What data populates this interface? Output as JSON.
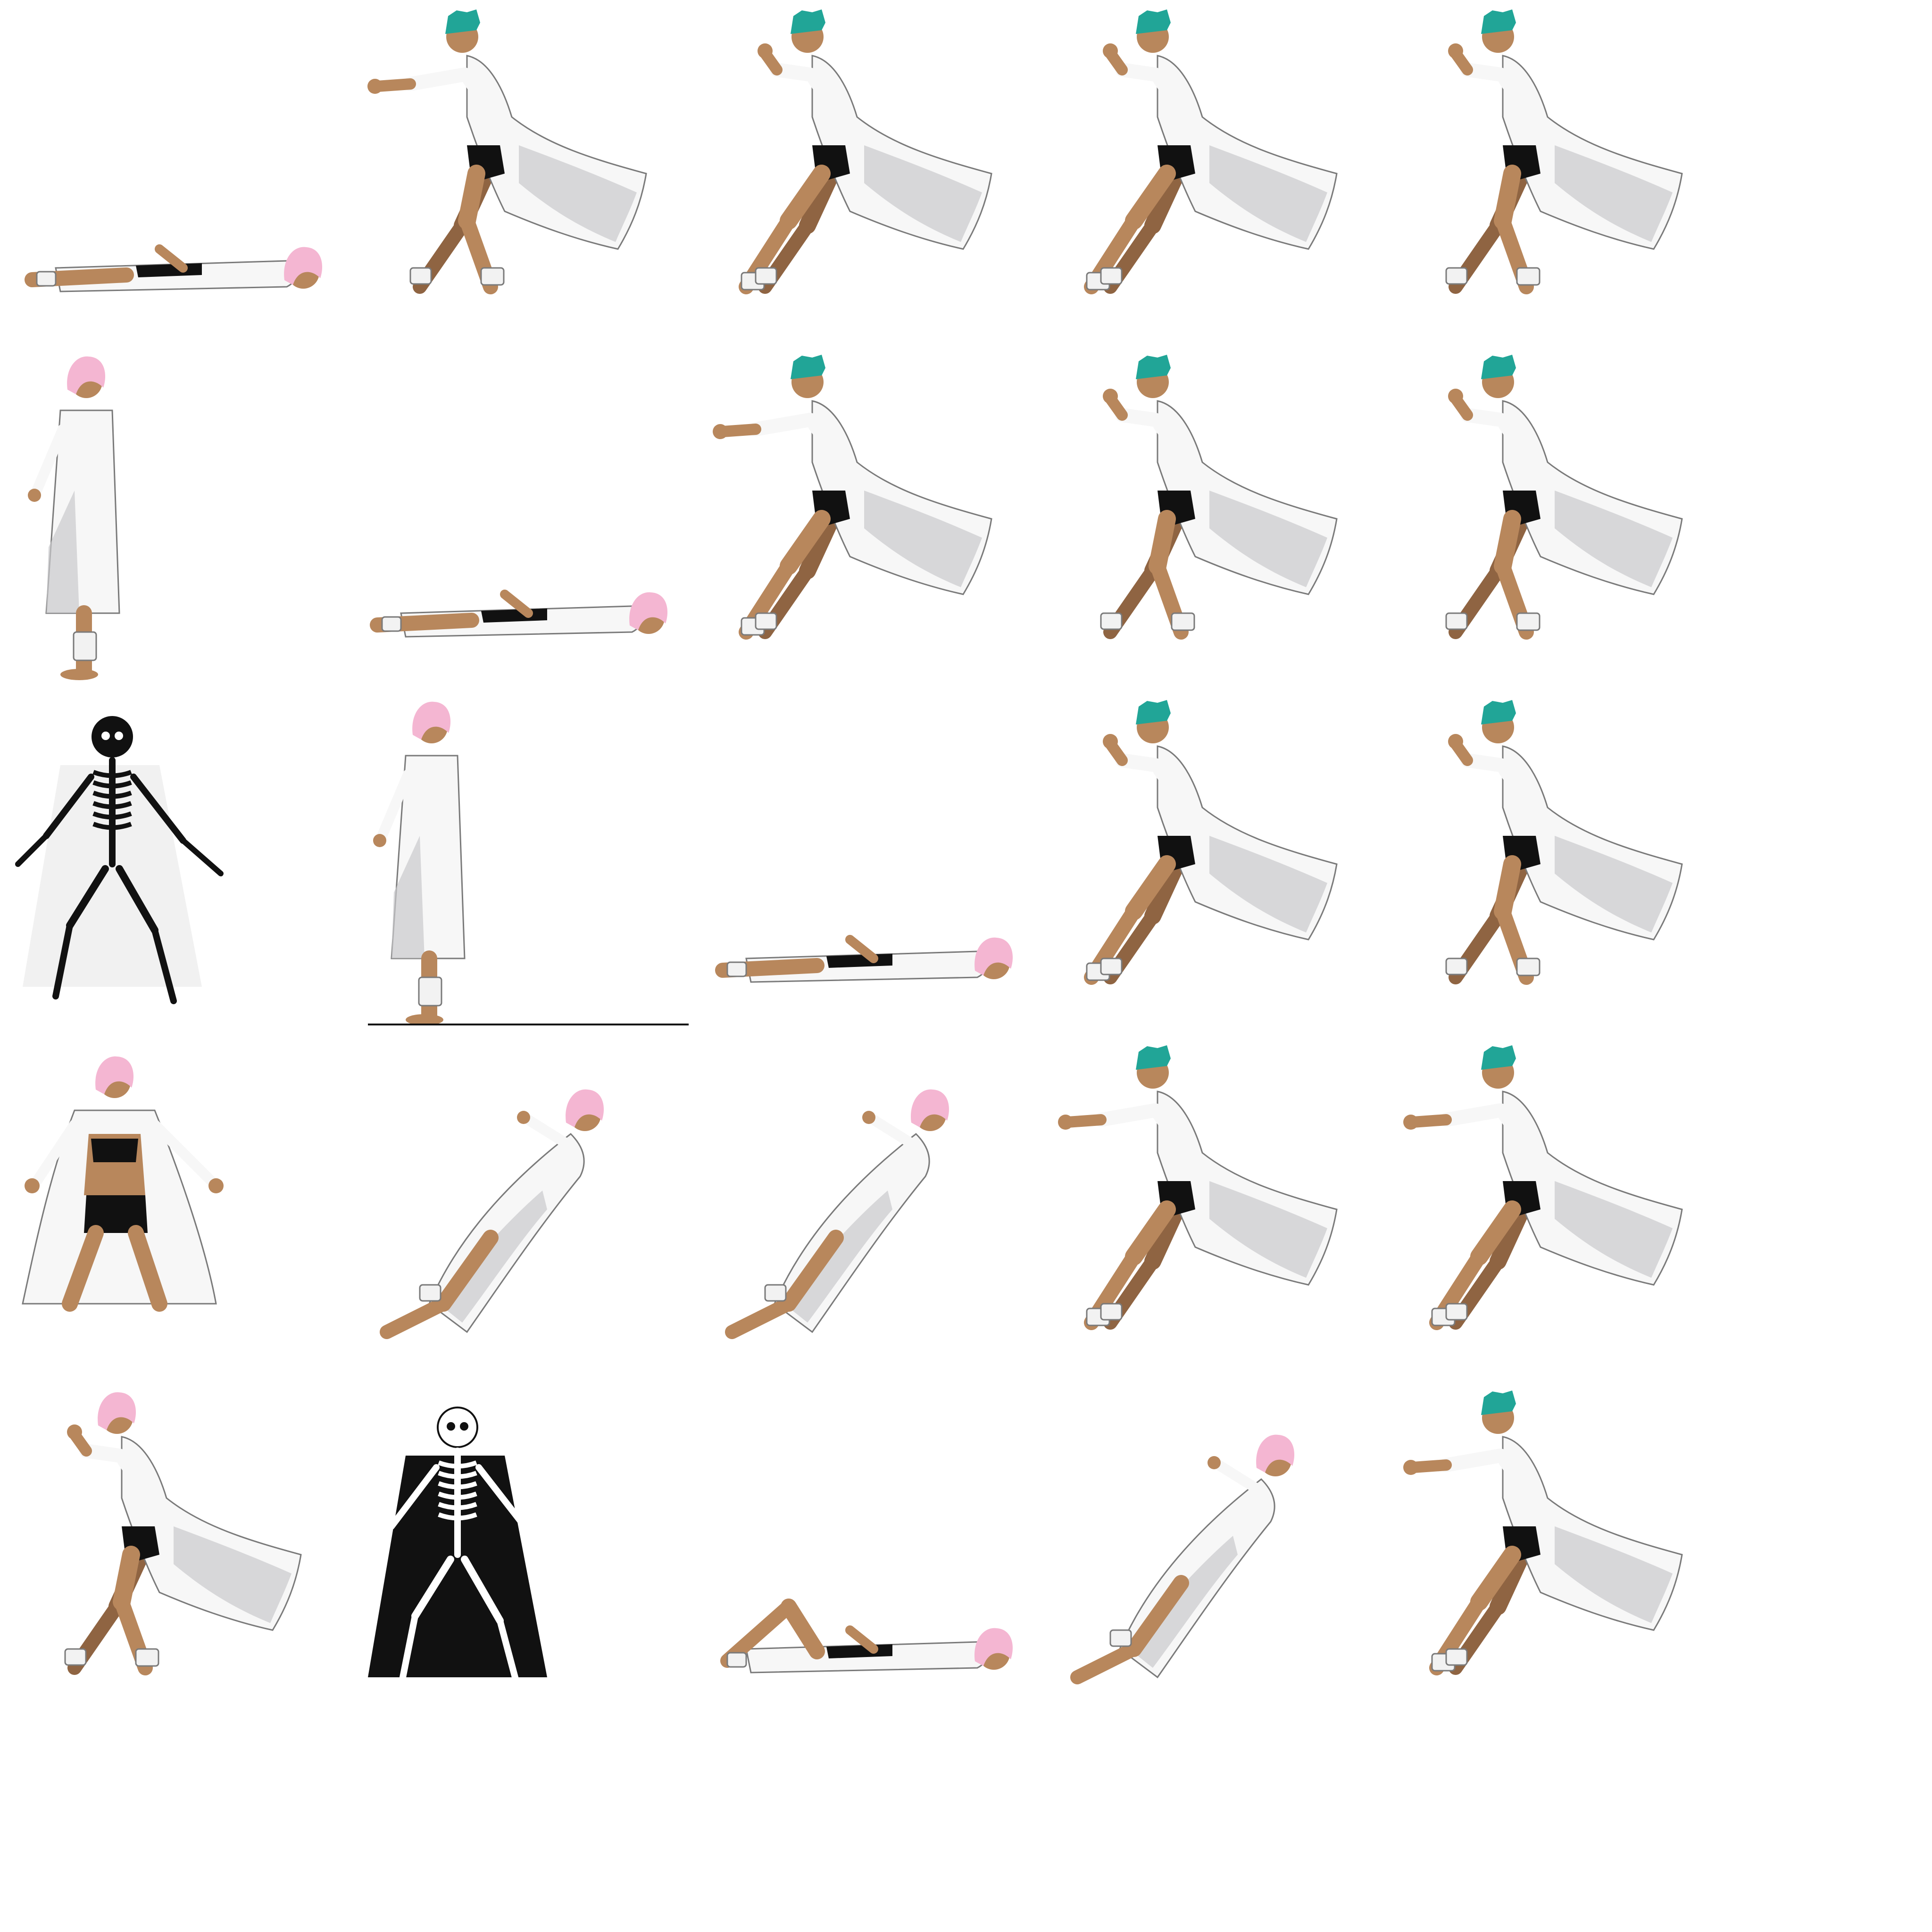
{
  "sheet": {
    "columns": 5,
    "rows": 5,
    "background": "#ffffff"
  },
  "colors": {
    "skin": "#b8875c",
    "skin_shade": "#8f6442",
    "coat": "#f7f7f7",
    "coat_shade": "#c9c9cc",
    "outline": "#7a7a7a",
    "shorts": "#111111",
    "bandage": "#f2f2f2",
    "teal_hair": "#21a597",
    "pink_hair": "#f4b6d2",
    "bone": "#ffffff",
    "dark": "#111111",
    "ground_line": "#111111"
  },
  "frames": [
    {
      "row": 0,
      "col": 0,
      "character": "pink-hair",
      "pose": "lying-down-arm-raised"
    },
    {
      "row": 0,
      "col": 1,
      "character": "teal-hair",
      "pose": "run-arms-up"
    },
    {
      "row": 0,
      "col": 2,
      "character": "teal-hair",
      "pose": "run-stride"
    },
    {
      "row": 0,
      "col": 3,
      "character": "teal-hair",
      "pose": "run-stride"
    },
    {
      "row": 0,
      "col": 4,
      "character": "teal-hair",
      "pose": "run-upright"
    },
    {
      "row": 1,
      "col": 0,
      "character": "pink-hair",
      "pose": "standing-side"
    },
    {
      "row": 1,
      "col": 1,
      "character": "pink-hair",
      "pose": "lying-down"
    },
    {
      "row": 1,
      "col": 2,
      "character": "teal-hair",
      "pose": "run-reach"
    },
    {
      "row": 1,
      "col": 3,
      "character": "teal-hair",
      "pose": "run-upright"
    },
    {
      "row": 1,
      "col": 4,
      "character": "teal-hair",
      "pose": "run-upright"
    },
    {
      "row": 2,
      "col": 0,
      "character": "skeleton-black",
      "pose": "shocked"
    },
    {
      "row": 2,
      "col": 1,
      "character": "pink-hair",
      "pose": "standing-on-line"
    },
    {
      "row": 2,
      "col": 2,
      "character": "pink-hair",
      "pose": "lying-down"
    },
    {
      "row": 2,
      "col": 3,
      "character": "teal-hair",
      "pose": "run-stride"
    },
    {
      "row": 2,
      "col": 4,
      "character": "teal-hair",
      "pose": "run-upright"
    },
    {
      "row": 3,
      "col": 0,
      "character": "pink-hair-front",
      "pose": "shocked"
    },
    {
      "row": 3,
      "col": 1,
      "character": "pink-hair",
      "pose": "falling-back"
    },
    {
      "row": 3,
      "col": 2,
      "character": "pink-hair",
      "pose": "leaning-back"
    },
    {
      "row": 3,
      "col": 3,
      "character": "teal-hair",
      "pose": "run-reach"
    },
    {
      "row": 3,
      "col": 4,
      "character": "teal-hair",
      "pose": "run-reach"
    },
    {
      "row": 4,
      "col": 0,
      "character": "pink-hair",
      "pose": "run-crouch"
    },
    {
      "row": 4,
      "col": 1,
      "character": "skeleton-white",
      "pose": "shocked"
    },
    {
      "row": 4,
      "col": 2,
      "character": "pink-hair",
      "pose": "lying-knee-up"
    },
    {
      "row": 4,
      "col": 3,
      "character": "pink-hair",
      "pose": "falling-back"
    },
    {
      "row": 4,
      "col": 4,
      "character": "teal-hair",
      "pose": "run-reach"
    }
  ]
}
